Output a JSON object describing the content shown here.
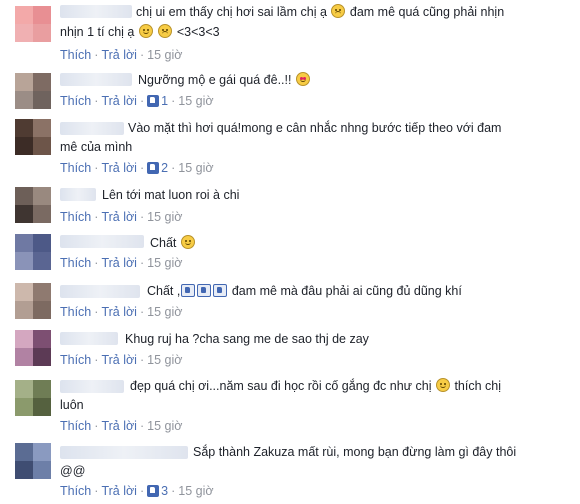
{
  "labels": {
    "like": "Thích",
    "reply": "Trả lời",
    "sep": "·"
  },
  "colors": {
    "link": "#4b6fb3",
    "muted": "#90949c",
    "text": "#1d2129"
  },
  "comments": [
    {
      "avatar": [
        "#f3a9a9",
        "#e88f93",
        "#f0b0b2",
        "#e99ea0"
      ],
      "line1": "chị ui em thấy chị hơi sai lầm chị ạ",
      "line1b": "đam mê quá cũng phải nhịn",
      "line2": "nhịn 1 tí chị ạ",
      "line2b": "<3<3<3",
      "likes": "",
      "time": "15 giờ"
    },
    {
      "avatar": [
        "#b8a498",
        "#7e6b63",
        "#9b8d86",
        "#6f635e"
      ],
      "line1": "Ngưỡng mộ e gái quá đê..!!",
      "likes": "1",
      "time": "15 giờ"
    },
    {
      "avatar": [
        "#4f3b32",
        "#8b7266",
        "#3c2c26",
        "#6d5549"
      ],
      "line1": "Vào mặt thì hơi quá!mong e cân nhắc nhng bước tiếp theo với đam",
      "line2": "mê của mình",
      "likes": "2",
      "time": "15 giờ"
    },
    {
      "avatar": [
        "#6d5f58",
        "#99897f",
        "#3f3531",
        "#7a6a62"
      ],
      "line1": "Lên tới mat luon roi à chi",
      "likes": "",
      "time": "15 giờ"
    },
    {
      "avatar": [
        "#6f79a3",
        "#4d5987",
        "#8a93b8",
        "#5a6592"
      ],
      "line1": "Chất",
      "likes": "",
      "time": "15 giờ"
    },
    {
      "avatar": [
        "#cdb8ac",
        "#8f7a70",
        "#b29e93",
        "#7d6a61"
      ],
      "line1": "Chất ,",
      "line1b": "đam mê mà đâu phải ai cũng đủ dũng khí",
      "likes": "",
      "time": "15 giờ"
    },
    {
      "avatar": [
        "#d4a7c0",
        "#7d4f72",
        "#b182a3",
        "#5c3a55"
      ],
      "line1": "Khug ruj ha ?cha sang me de sao thj de zay",
      "likes": "",
      "time": "15 giờ"
    },
    {
      "avatar": [
        "#a4b088",
        "#6f7d55",
        "#8b9a6c",
        "#55613f"
      ],
      "line1": "đẹp quá chị ơi...năm sau đi học rồi cố gắng đc như chị",
      "line1b": "thích chị",
      "line2": "luôn",
      "likes": "",
      "time": "15 giờ"
    },
    {
      "avatar": [
        "#5b6c93",
        "#8a9ac0",
        "#3f4d72",
        "#6d7fa8"
      ],
      "line1": "Sắp thành Zakuza mất rùi, mong bạn đừng làm gì đây thôi",
      "line2": "@@",
      "likes": "3",
      "time": "15 giờ"
    }
  ]
}
